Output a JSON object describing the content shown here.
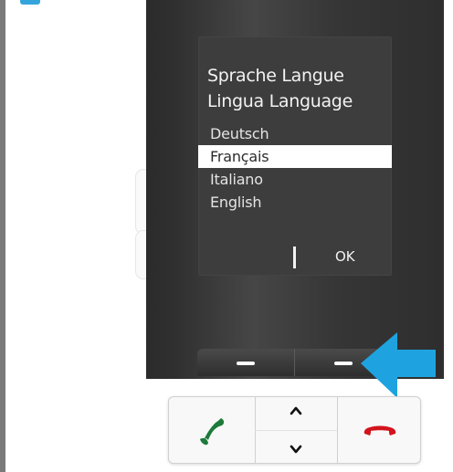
{
  "screen": {
    "title_line1": "Sprache Langue",
    "title_line2": "Lingua Language",
    "languages": [
      {
        "label": "Deutsch",
        "selected": false
      },
      {
        "label": "Français",
        "selected": true
      },
      {
        "label": "Italiano",
        "selected": false
      },
      {
        "label": "English",
        "selected": false
      }
    ],
    "softkey_right_label": "OK"
  },
  "colors": {
    "accent_arrow": "#1ea3e0",
    "call_green": "#1d7a3a",
    "end_red": "#d3141c"
  },
  "icons": {
    "call": "phone-handset-green",
    "end": "phone-handset-red",
    "up": "chevron-up",
    "down": "chevron-down",
    "pointer": "arrow-left-blue"
  }
}
